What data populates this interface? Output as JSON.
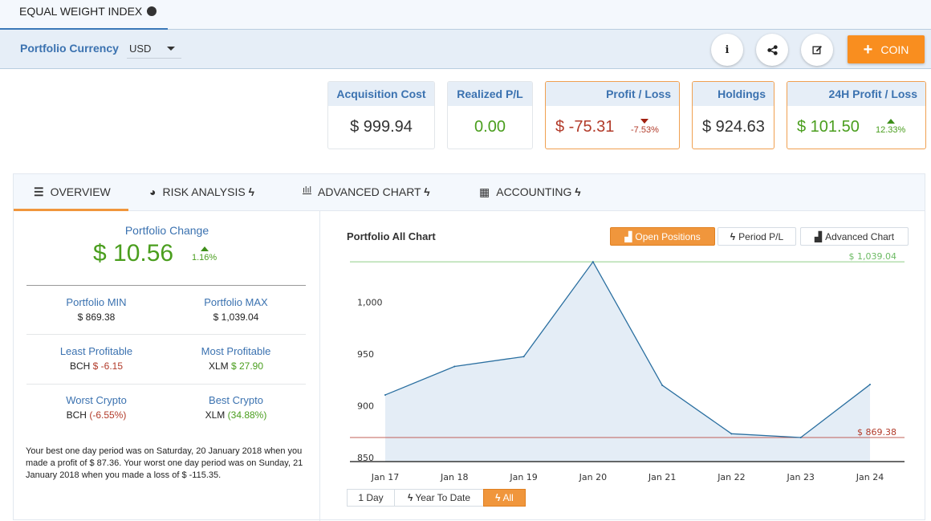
{
  "top_tab": {
    "label": "EQUAL WEIGHT INDEX",
    "icon": "globe-icon"
  },
  "currency_bar": {
    "label": "Portfolio Currency",
    "selected": "USD"
  },
  "actions": {
    "info": "i",
    "coin_label": "COIN"
  },
  "cards": [
    {
      "title": "Acquisition Cost",
      "value": "$ 999.94"
    },
    {
      "title": "Realized P/L",
      "value": "0.00"
    },
    {
      "title": "Profit / Loss",
      "value": "$ -75.31",
      "pct": "-7.53%"
    },
    {
      "title": "Holdings",
      "value": "$ 924.63"
    },
    {
      "title": "24H Profit / Loss",
      "value": "$ 101.50",
      "pct": "12.33%"
    }
  ],
  "tabs": [
    {
      "label": "OVERVIEW",
      "icon": "list-icon",
      "bolt": ""
    },
    {
      "label": "RISK ANALYSIS",
      "icon": "pie-chart-icon",
      "bolt": "ϟ"
    },
    {
      "label": "ADVANCED CHART",
      "icon": "bar-chart-icon",
      "bolt": "ϟ"
    },
    {
      "label": "ACCOUNTING",
      "icon": "calculator-icon",
      "bolt": "ϟ"
    }
  ],
  "overview": {
    "change_title": "Portfolio Change",
    "change_value": "$ 10.56",
    "change_pct": "1.16%",
    "stats": [
      {
        "label": "Portfolio MIN",
        "value": "$ 869.38"
      },
      {
        "label": "Portfolio MAX",
        "value": "$ 1,039.04"
      },
      {
        "label": "Least Profitable",
        "coin": "BCH",
        "value": "$ -6.15"
      },
      {
        "label": "Most Profitable",
        "coin": "XLM",
        "value": "$ 27.90"
      },
      {
        "label": "Worst Crypto",
        "coin": "BCH",
        "value": "(-6.55%)"
      },
      {
        "label": "Best Crypto",
        "coin": "XLM",
        "value": "(34.88%)"
      }
    ],
    "summary": "Your best one day period was on Saturday, 20 January 2018 when you made a profit of $ 87.36. Your worst one day period was on Sunday, 21 January 2018 when you made a loss of $ -115.35."
  },
  "chart_controls": {
    "buttons": [
      "Open Positions",
      "Period P/L",
      "Advanced Chart"
    ],
    "active": "Open Positions",
    "ranges": [
      "1 Day",
      "Year To Date",
      "All"
    ],
    "active_range": "All"
  },
  "chart_data": {
    "type": "area",
    "title": "Portfolio All Chart",
    "categories": [
      "Jan 17",
      "Jan 18",
      "Jan 19",
      "Jan 20",
      "Jan 21",
      "Jan 22",
      "Jan 23",
      "Jan 24"
    ],
    "values": [
      910.5,
      938,
      947.5,
      1039.04,
      919.8,
      873,
      869.38,
      920.5
    ],
    "ylim": [
      850,
      1039.04
    ],
    "yticks": [
      850,
      900,
      950,
      1000
    ],
    "ytick_labels": [
      "850",
      "900",
      "950",
      "1,000"
    ],
    "max_line": {
      "value": 1039.04,
      "label": "$ 1,039.04",
      "color": "#8fce88"
    },
    "min_line": {
      "value": 869.38,
      "label": "$ 869.38",
      "color": "#c0605a"
    },
    "line_color": "#2a6fa0",
    "fill_color": "#e4edf6",
    "xlabel": "",
    "ylabel": "",
    "grid": false
  }
}
